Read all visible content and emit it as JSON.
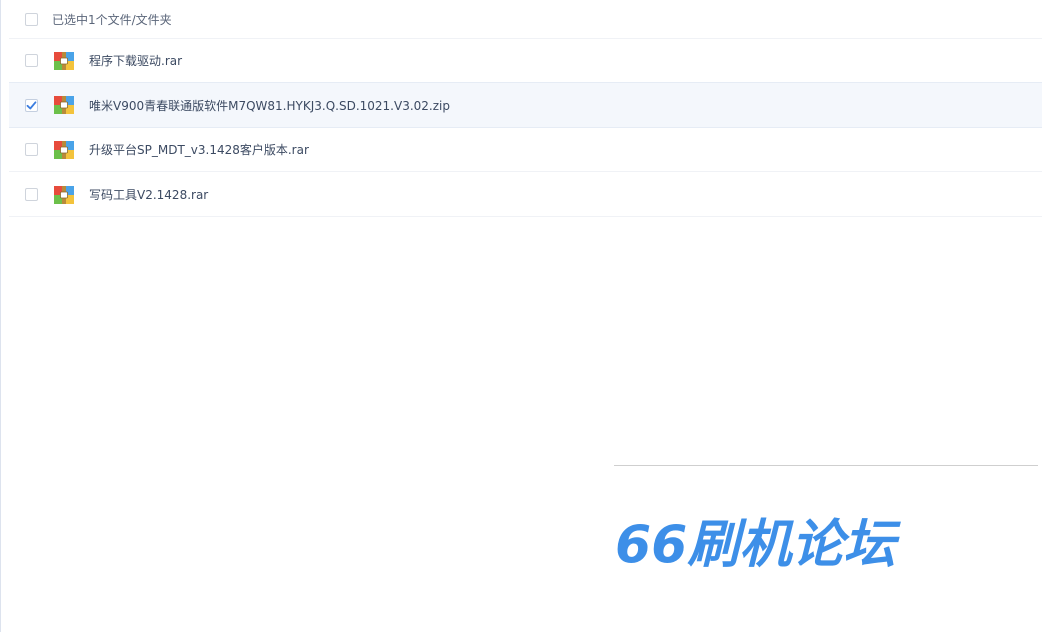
{
  "header": {
    "selection_label": "已选中1个文件/文件夹",
    "all_checked": false
  },
  "files": [
    {
      "name": "程序下载驱动.rar",
      "type": "rar",
      "checked": false
    },
    {
      "name": "唯米V900青春联通版软件M7QW81.HYKJ3.Q.SD.1021.V3.02.zip",
      "type": "zip",
      "checked": true
    },
    {
      "name": "升级平台SP_MDT_v3.1428客户版本.rar",
      "type": "rar",
      "checked": false
    },
    {
      "name": "写码工具V2.1428.rar",
      "type": "rar",
      "checked": false
    }
  ],
  "watermark": {
    "text": "66刷机论坛",
    "color": "#3d8fe8"
  },
  "colors": {
    "check": "#3b7de0",
    "selected_row": "#f4f7fc",
    "icon_red": "#e74b3c",
    "icon_blue": "#4aa3e8",
    "icon_green": "#6cc04a",
    "icon_yellow": "#f3c33c"
  }
}
